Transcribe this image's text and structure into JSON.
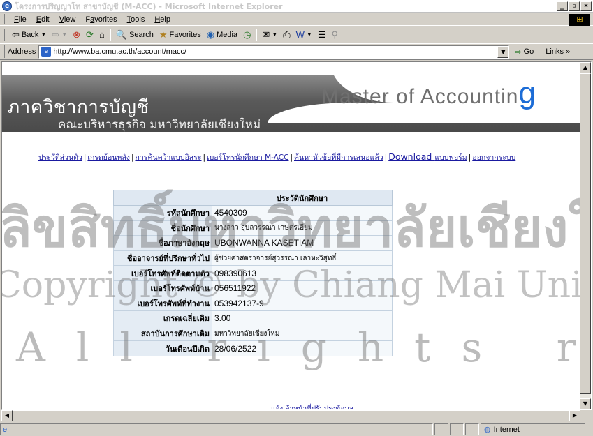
{
  "window": {
    "title": "โครงการปริญญาโท สาขาบัญชี (M-ACC) - Microsoft Internet Explorer",
    "controls": {
      "minimize": "_",
      "maximize": "▫",
      "close": "×"
    }
  },
  "menu": {
    "items": [
      {
        "key": "F",
        "rest": "ile"
      },
      {
        "key": "E",
        "rest": "dit"
      },
      {
        "key": "V",
        "rest": "iew"
      },
      {
        "pre": "F",
        "key": "a",
        "rest": "vorites"
      },
      {
        "key": "T",
        "rest": "ools"
      },
      {
        "key": "H",
        "rest": "elp"
      }
    ]
  },
  "toolbar": {
    "back": "Back",
    "search": "Search",
    "favorites": "Favorites",
    "media": "Media"
  },
  "address": {
    "label": "Address",
    "url": "http://www.ba.cmu.ac.th/account/macc/",
    "go": "Go",
    "links": "Links"
  },
  "banner": {
    "thai_title": "ภาควิชาการบัญชี",
    "thai_subtitle": "คณะบริหารธุรกิจ มหาวิทยาลัยเชียงใหม่",
    "english_title": "Master of Accountin",
    "english_title_last": "g"
  },
  "nav": {
    "links": [
      "ประวัติส่วนตัว",
      "เกรดย้อนหลัง",
      "การค้นคว้าแบบอิสระ",
      "เบอร์โทรนักศึกษา M-ACC",
      "ค้นหาหัวข้อที่มีการเสนอแล้ว",
      "Download",
      "ออกจากระบบ"
    ],
    "download_suffix": "แบบฟอร์ม",
    "separator": "|"
  },
  "profile": {
    "heading": "ประวัตินักศึกษา",
    "rows": [
      {
        "label": "รหัสนักศึกษา",
        "value": "4540309"
      },
      {
        "label": "ชื่อนักศึกษา",
        "value": "นางสาว อุบลวรรณา เกษตรเอี่ยม"
      },
      {
        "label": "ชื่อภาษาอังกฤษ",
        "value": "UBONWANNA KASETIAM"
      },
      {
        "label": "ชื่ออาจารย์ที่ปรึกษาทั่วไป",
        "value": "ผู้ช่วยศาสตราจารย์สุวรรณา เลาหะวิสุทธิ์"
      },
      {
        "label": "เบอร์โทรศัพท์ติดตามตัว",
        "value": "098390613"
      },
      {
        "label": "เบอร์โทรศัพท์บ้าน",
        "value": "056511922"
      },
      {
        "label": "เบอร์โทรศัพท์ที่ทำงาน",
        "value": "053942137-9"
      },
      {
        "label": "เกรดเฉลี่ยเดิม",
        "value": "3.00"
      },
      {
        "label": "สถาบันการศึกษาเดิม",
        "value": "มหาวิทยาลัยเชียงใหม่"
      },
      {
        "label": "วันเดือนปีเกิด",
        "value": "28/06/2522"
      }
    ]
  },
  "footer_link": "แจ้งเจ้าหน้าที่ปรับปรุงข้อมูล",
  "watermark": {
    "line1": "ลิขสิทธิ์มหาวิทยาลัยเชียงใหม่",
    "line2": "Copyright © by Chiang Mai University",
    "line3": "All rights reserved"
  },
  "status": {
    "zone": "Internet"
  },
  "colors": {
    "link": "#1a1aa0",
    "brand_accent": "#1c6cd6",
    "table_bg": "#e4ecf4"
  }
}
